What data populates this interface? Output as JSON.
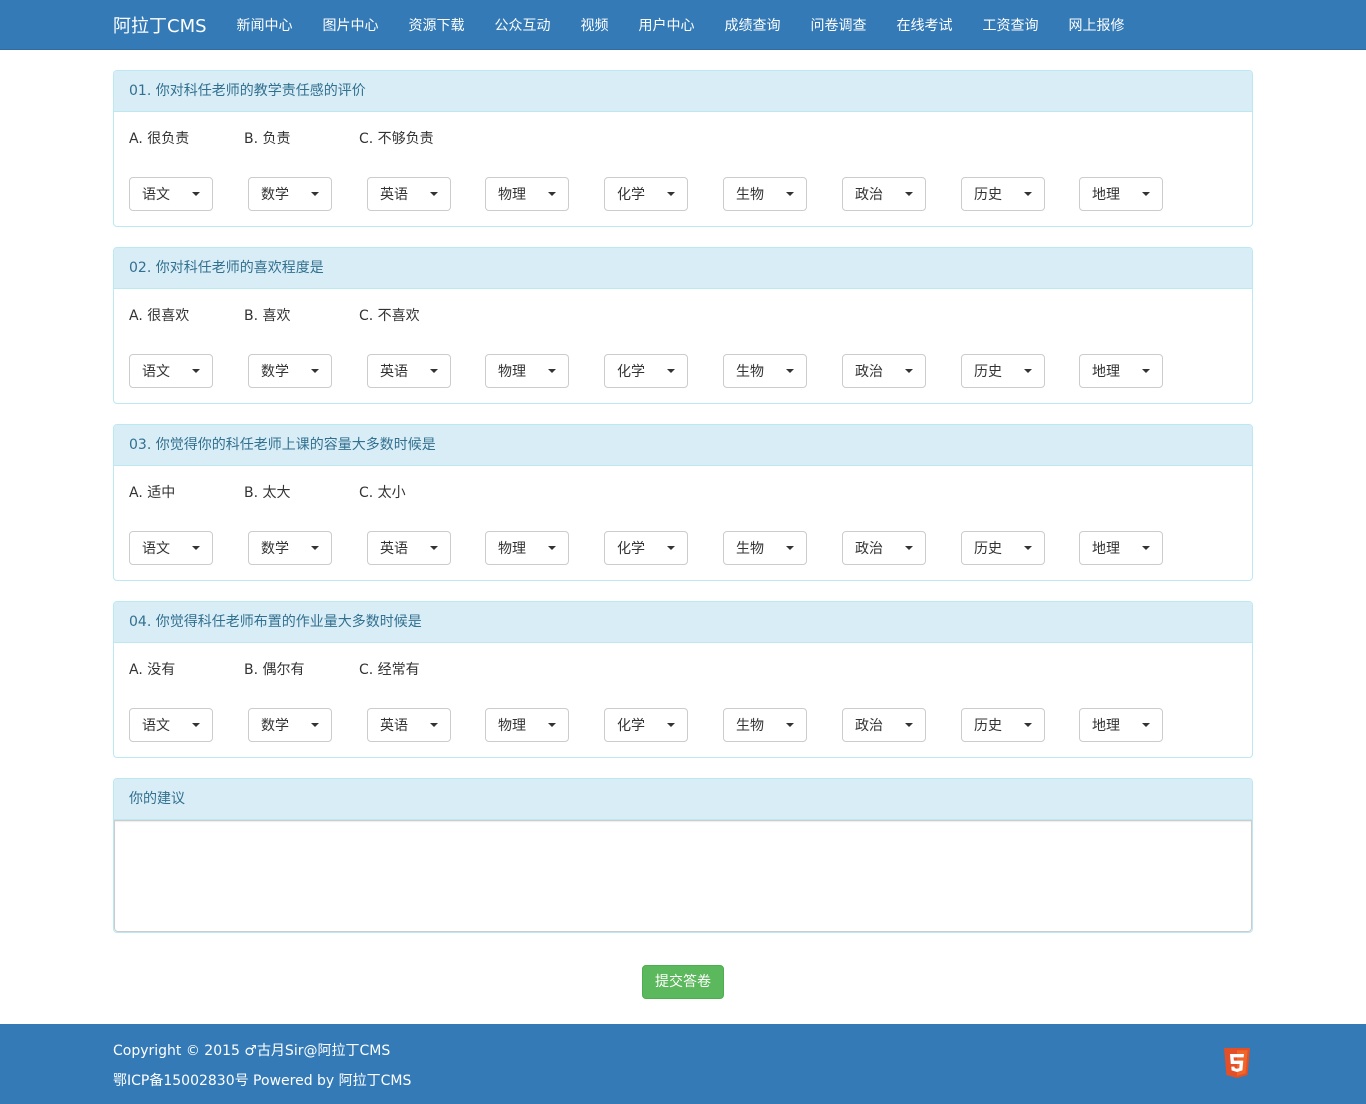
{
  "nav": {
    "brand": "阿拉丁CMS",
    "items": [
      "新闻中心",
      "图片中心",
      "资源下载",
      "公众互动",
      "视频",
      "用户中心",
      "成绩查询",
      "问卷调查",
      "在线考试",
      "工资查询",
      "网上报修"
    ]
  },
  "questions": [
    {
      "title": "01. 你对科任老师的教学责任感的评价",
      "options": [
        "A. 很负责",
        "B. 负责",
        "C. 不够负责"
      ]
    },
    {
      "title": "02. 你对科任老师的喜欢程度是",
      "options": [
        "A. 很喜欢",
        "B. 喜欢",
        "C. 不喜欢"
      ]
    },
    {
      "title": "03. 你觉得你的科任老师上课的容量大多数时候是",
      "options": [
        "A. 适中",
        "B. 太大",
        "C. 太小"
      ]
    },
    {
      "title": "04. 你觉得科任老师布置的作业量大多数时候是",
      "options": [
        "A. 没有",
        "B. 偶尔有",
        "C. 经常有"
      ]
    }
  ],
  "subjects": [
    "语文",
    "数学",
    "英语",
    "物理",
    "化学",
    "生物",
    "政治",
    "历史",
    "地理"
  ],
  "suggestion": {
    "title": "你的建议",
    "value": ""
  },
  "submit_label": "提交答卷",
  "footer": {
    "copyright": "Copyright © 2015 ♂古月Sir@阿拉丁CMS",
    "icp": "鄂ICP备15002830号 Powered by 阿拉丁CMS",
    "badge_icon": "html5-icon"
  },
  "colors": {
    "primary": "#337ab7",
    "panel_heading": "#d9edf7",
    "success": "#5cb85c"
  }
}
